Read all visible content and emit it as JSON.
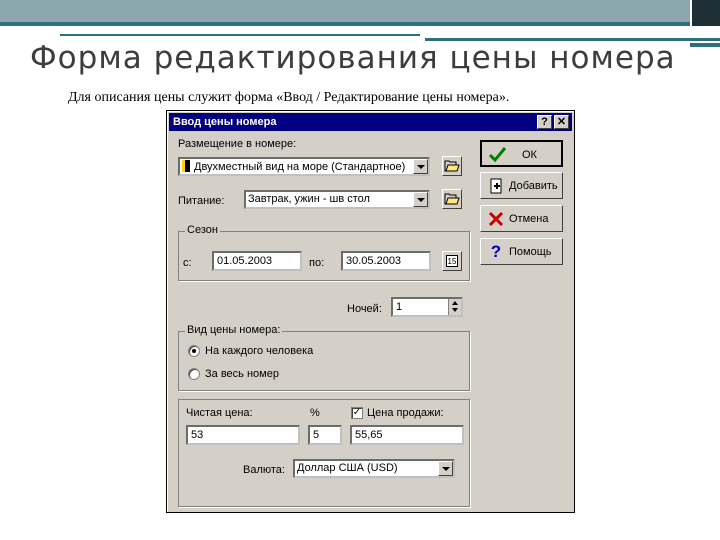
{
  "slide": {
    "title": "Форма редактирования цены номера",
    "caption": "Для описания цены служит форма «Ввод / Редактирование цены номера»."
  },
  "dialog": {
    "title": "Ввод цены номера",
    "help_btn": "?",
    "close_btn": "✕",
    "placement_label": "Размещение в номере:",
    "placement_value": "Двухместный вид на море (Стандартное)",
    "meal_label": "Питание:",
    "meal_value": "Завтрак, ужин - шв стол",
    "season_group": "Сезон",
    "from_label": "с:",
    "from_value": "01.05.2003",
    "to_label": "по:",
    "to_value": "30.05.2003",
    "calendar_icon_text": "15",
    "nights_label": "Ночей:",
    "nights_value": "1",
    "price_type_group": "Вид цены номера:",
    "per_person": "На каждого человека",
    "whole_room": "За весь номер",
    "net_price_label": "Чистая цена:",
    "net_price_value": "53",
    "percent_label": "%",
    "percent_value": "5",
    "sale_price_label": "Цена продажи:",
    "sale_price_checked": true,
    "sale_price_value": "55,65",
    "currency_label": "Валюта:",
    "currency_value": "Доллар США (USD)",
    "buttons": {
      "ok": "ОК",
      "add": "Добавить",
      "cancel": "Отмена",
      "help": "Помощь"
    }
  },
  "colors": {
    "title_bar": "#000080",
    "dialog_bg": "#d4d0c8",
    "accent": "#2f6f7d"
  }
}
